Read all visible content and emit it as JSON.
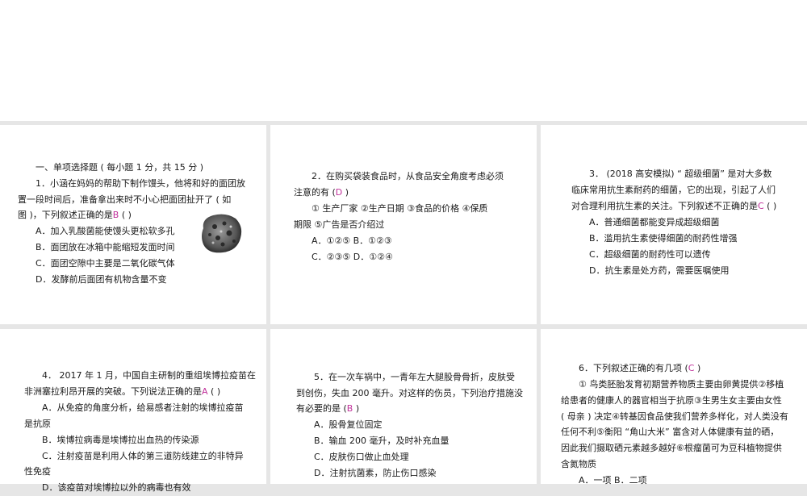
{
  "cards": {
    "c1": {
      "section_title": "一、单项选择题 ( 每小题 1 分，共 15 分 )",
      "stem1": "1．小涵在妈妈的帮助下制作馒头，他将和好的面团放",
      "stem2": "置一段时间后，准备拿出来时不小心把面团扯开了 ( 如",
      "stem3a": "图 )，下列叙述正确的是",
      "stem3_ans": "B",
      "stem3b": " (     )",
      "optA": "A．加入乳酸菌能使馒头更松软多孔",
      "optB": "B．面团放在冰箱中能缩短发面时间",
      "optC": "C．面团空隙中主要是二氧化碳气体",
      "optD": "D．发酵前后面团有机物含量不变"
    },
    "c2": {
      "stem1": "2．在购买袋装食品时，从食品安全角度考虑必须",
      "stem2a": "注意的有 (",
      "stem2_ans": "D",
      "stem2b": "   )",
      "items1": "① 生产厂家   ②生产日期   ③食品的价格   ④保质",
      "items2": "期限   ⑤广告是否介绍过",
      "optAB": "A．①②⑤   B．①②③",
      "optCD": "C．②③⑤   D．①②④"
    },
    "c3": {
      "stem1": "3． (2018 高安模拟) “ 超级细菌” 是对大多数",
      "stem2": "临床常用抗生素耐药的细菌，它的出现，引起了人们",
      "stem3a": "对合理利用抗生素的关注。下列叙述不正确的是",
      "stem3_ans": "C",
      "stem3b": " (     )",
      "optA": "A．普通细菌都能变异成超级细菌",
      "optB": "B．滥用抗生素使得细菌的耐药性增强",
      "optC": "C．超级细菌的耐药性可以遗传",
      "optD": "D．抗生素是处方药，需要医嘱使用"
    },
    "c4": {
      "stem1": "4． 2017 年 1 月，中国自主研制的重组埃博拉疫苗在",
      "stem2a": "非洲塞拉利昂开展的突破。下列说法正确的是",
      "stem2_ans": "A",
      "stem2b": " (     )",
      "optA1": "A．从免疫的角度分析，给易感者注射的埃博拉疫苗",
      "optA2": "是抗原",
      "optB": "B．埃博拉病毒是埃博拉出血热的传染源",
      "optC1": "C．注射疫苗是利用人体的第三道防线建立的非特异",
      "optC2": "性免疫",
      "optD": "D．该疫苗对埃博拉以外的病毒也有效"
    },
    "c5": {
      "stem1": "5．在一次车祸中，一青年左大腿股骨骨折，皮肤受",
      "stem2": "到创伤，失血 200 毫升。对这样的伤员，下列治疗措施没",
      "stem3a": "有必要的是 (",
      "stem3_ans": "B",
      "stem3b": "   )",
      "optA": "A．股骨复位固定",
      "optB": "B．输血 200 毫升，及时补充血量",
      "optC": "C．皮肤伤口做止血处理",
      "optD": "D．注射抗菌素，防止伤口感染"
    },
    "c6": {
      "stem1a": "6．下列叙述正确的有几项 (",
      "stem1_ans": "C",
      "stem1b": "   )",
      "b1": "① 鸟类胚胎发育初期营养物质主要由卵黄提供②移植",
      "b2": "给患者的健康人的器官相当于抗原③生男生女主要由女性",
      "b3": "( 母亲 ) 决定④转基因食品使我们营养多样化，对人类没有",
      "b4": "任何不利⑤衡阳 “角山大米” 富含对人体健康有益的硒，",
      "b5": "因此我们摄取硒元素越多越好⑥根瘤菌可为豆科植物提供",
      "b6": "含氮物质",
      "optAB": "A．一项               B．二项"
    }
  },
  "icons": {
    "photo": "bread-dough-photo-icon"
  }
}
